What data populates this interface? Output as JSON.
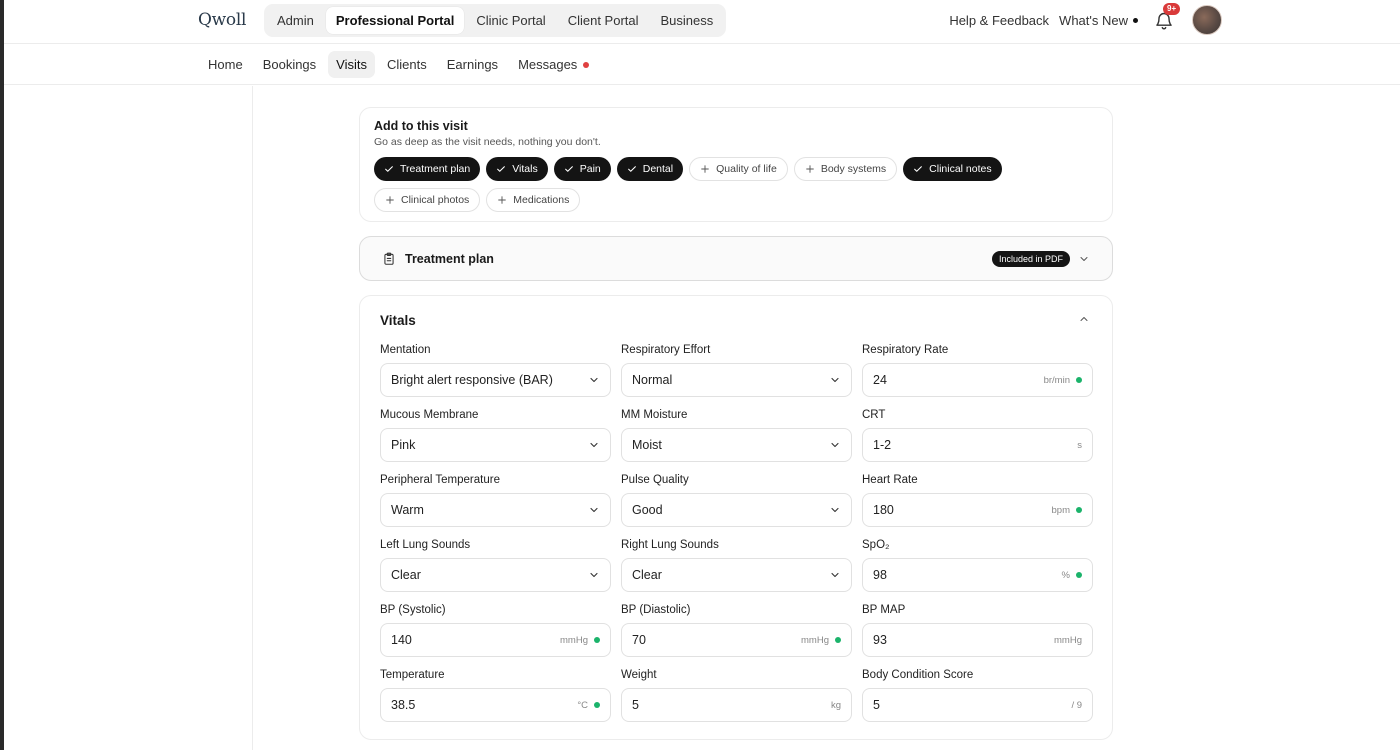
{
  "app": {
    "logo": "Qwoll"
  },
  "portals": [
    "Admin",
    "Professional Portal",
    "Clinic Portal",
    "Client Portal",
    "Business"
  ],
  "topbar": {
    "help": "Help & Feedback",
    "whats_new": "What's New",
    "notif_badge": "9+"
  },
  "subnav": [
    "Home",
    "Bookings",
    "Visits",
    "Clients",
    "Earnings",
    "Messages"
  ],
  "add_to_visit": {
    "title": "Add to this visit",
    "subtitle": "Go as deep as the visit needs, nothing you don't.",
    "chips": [
      {
        "label": "Treatment plan",
        "on": true
      },
      {
        "label": "Vitals",
        "on": true
      },
      {
        "label": "Pain",
        "on": true
      },
      {
        "label": "Dental",
        "on": true
      },
      {
        "label": "Quality of life",
        "on": false
      },
      {
        "label": "Body systems",
        "on": false
      },
      {
        "label": "Clinical notes",
        "on": true
      },
      {
        "label": "Clinical photos",
        "on": false
      },
      {
        "label": "Medications",
        "on": false
      }
    ]
  },
  "treatment_plan": {
    "title": "Treatment plan",
    "badge": "Included in PDF"
  },
  "vitals": {
    "title": "Vitals",
    "fields": [
      {
        "label": "Mentation",
        "value": "Bright alert responsive (BAR)",
        "select": true
      },
      {
        "label": "Respiratory Effort",
        "value": "Normal",
        "select": true
      },
      {
        "label": "Respiratory Rate",
        "value": "24",
        "unit": "br/min",
        "dot": true
      },
      {
        "label": "Mucous Membrane",
        "value": "Pink",
        "select": true
      },
      {
        "label": "MM Moisture",
        "value": "Moist",
        "select": true
      },
      {
        "label": "CRT",
        "value": "1-2",
        "unit": "s",
        "dot": false
      },
      {
        "label": "Peripheral Temperature",
        "value": "Warm",
        "select": true
      },
      {
        "label": "Pulse Quality",
        "value": "Good",
        "select": true
      },
      {
        "label": "Heart Rate",
        "value": "180",
        "unit": "bpm",
        "dot": true
      },
      {
        "label": "Left Lung Sounds",
        "value": "Clear",
        "select": true
      },
      {
        "label": "Right Lung Sounds",
        "value": "Clear",
        "select": true
      },
      {
        "label": "SpO₂",
        "value": "98",
        "unit": "%",
        "dot": true
      },
      {
        "label": "BP (Systolic)",
        "value": "140",
        "unit": "mmHg",
        "dot": true
      },
      {
        "label": "BP (Diastolic)",
        "value": "70",
        "unit": "mmHg",
        "dot": true
      },
      {
        "label": "BP MAP",
        "value": "93",
        "unit": "mmHg",
        "dot": false
      },
      {
        "label": "Temperature",
        "value": "38.5",
        "unit": "°C",
        "dot": true
      },
      {
        "label": "Weight",
        "value": "5",
        "unit": "kg",
        "dot": false
      },
      {
        "label": "Body Condition Score",
        "value": "5",
        "unit": "/ 9",
        "dot": false
      }
    ]
  }
}
